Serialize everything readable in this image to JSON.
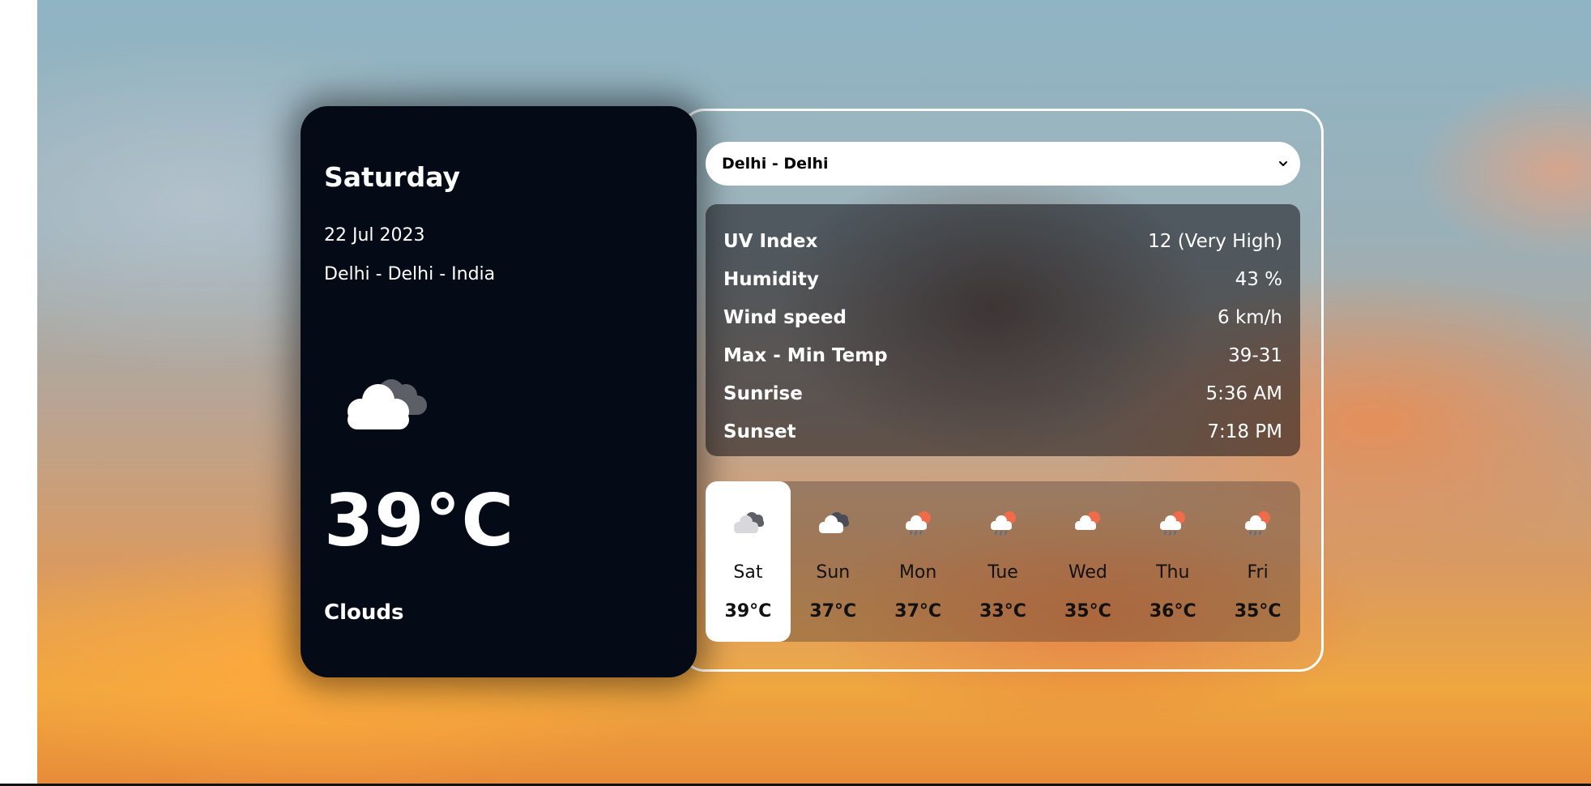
{
  "current": {
    "day": "Saturday",
    "date": "22 Jul 2023",
    "location": "Delhi - Delhi - India",
    "temperature": "39°C",
    "condition": "Clouds",
    "icon": "clouds-icon"
  },
  "city_select": {
    "value": "Delhi - Delhi",
    "icon": "chevron-down-icon"
  },
  "details": [
    {
      "label": "UV Index",
      "value": "12 (Very High)"
    },
    {
      "label": "Humidity",
      "value": "43 %"
    },
    {
      "label": "Wind speed",
      "value": "6 km/h"
    },
    {
      "label": "Max - Min Temp",
      "value": "39-31"
    },
    {
      "label": "Sunrise",
      "value": "5:36 AM"
    },
    {
      "label": "Sunset",
      "value": "7:18 PM"
    }
  ],
  "forecast": [
    {
      "day": "Sat",
      "temp": "39°C",
      "icon": "clouds-icon",
      "active": true
    },
    {
      "day": "Sun",
      "temp": "37°C",
      "icon": "clouds-icon",
      "active": false
    },
    {
      "day": "Mon",
      "temp": "37°C",
      "icon": "sun-rain-cloud-icon",
      "active": false
    },
    {
      "day": "Tue",
      "temp": "33°C",
      "icon": "sun-rain-cloud-icon",
      "active": false
    },
    {
      "day": "Wed",
      "temp": "35°C",
      "icon": "sun-cloud-icon",
      "active": false
    },
    {
      "day": "Thu",
      "temp": "36°C",
      "icon": "sun-rain-cloud-icon",
      "active": false
    },
    {
      "day": "Fri",
      "temp": "35°C",
      "icon": "sun-rain-cloud-icon",
      "active": false
    }
  ],
  "colors": {
    "card_bg": "#040b16",
    "active_day_bg": "#ffffff",
    "sun": "#ef6b4a",
    "rain": "#2f6fb0"
  }
}
